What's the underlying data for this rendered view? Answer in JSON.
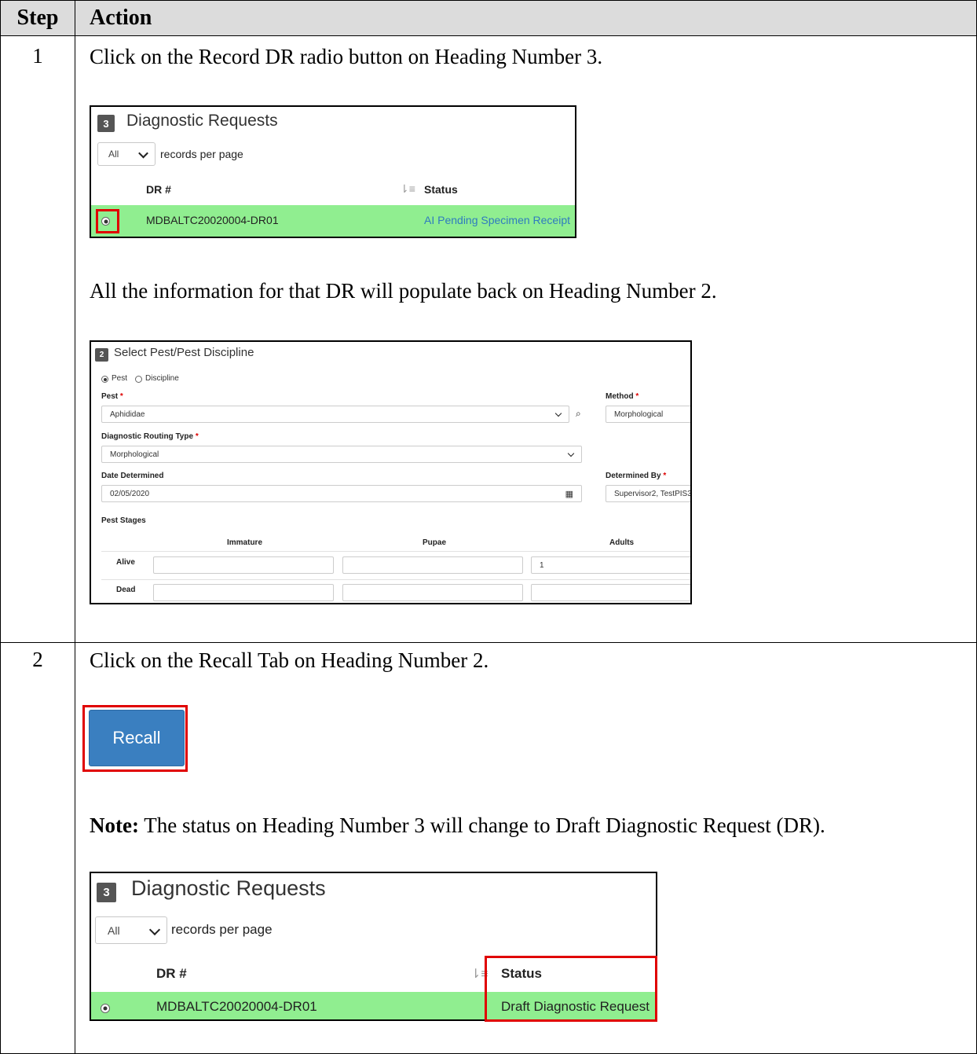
{
  "table": {
    "header_step": "Step",
    "header_action": "Action"
  },
  "step1": {
    "number": "1",
    "instruction": "Click on the Record DR radio button on Heading Number 3.",
    "followup": "All the information for that DR will populate back on Heading Number 2."
  },
  "dr_panel_1": {
    "badge": "3",
    "title": "Diagnostic Requests",
    "per_page_value": "All",
    "per_page_label": "records per page",
    "col_dr": "DR #",
    "col_status": "Status",
    "row_dr": "MDBALTC20020004-DR01",
    "row_status": "AI Pending Specimen Receipt",
    "row_color": "#90ee90",
    "status_color": "#2f7bbf"
  },
  "pest_panel": {
    "badge": "2",
    "title": "Select Pest/Pest Discipline",
    "radio_pest": "Pest",
    "radio_discipline": "Discipline",
    "selected_radio": "Pest",
    "pest_label": "Pest",
    "pest_value": "Aphididae",
    "method_label": "Method",
    "method_value": "Morphological",
    "routing_label": "Diagnostic Routing Type",
    "routing_value": "Morphological",
    "date_label": "Date Determined",
    "date_value": "02/05/2020",
    "determined_by_label": "Determined By",
    "determined_by_value": "Supervisor2, TestPIS3",
    "required_mark": "*",
    "stages_label": "Pest Stages",
    "col_immature": "Immature",
    "col_pupae": "Pupae",
    "col_adults": "Adults",
    "row_alive": "Alive",
    "row_dead": "Dead",
    "alive_adults": "1"
  },
  "step2": {
    "number": "2",
    "instruction": "Click on the Recall Tab on Heading Number 2.",
    "recall_label": "Recall",
    "recall_color": "#3a7fc0",
    "note_bold": "Note:",
    "note_text": " The status on Heading Number 3 will change to Draft Diagnostic Request (DR)."
  },
  "dr_panel_2": {
    "badge": "3",
    "title": "Diagnostic Requests",
    "per_page_value": "All",
    "per_page_label": "records per page",
    "col_dr": "DR #",
    "col_status": "Status",
    "row_dr": "MDBALTC20020004-DR01",
    "row_status": "Draft Diagnostic Request",
    "highlight_color": "#e00000"
  }
}
